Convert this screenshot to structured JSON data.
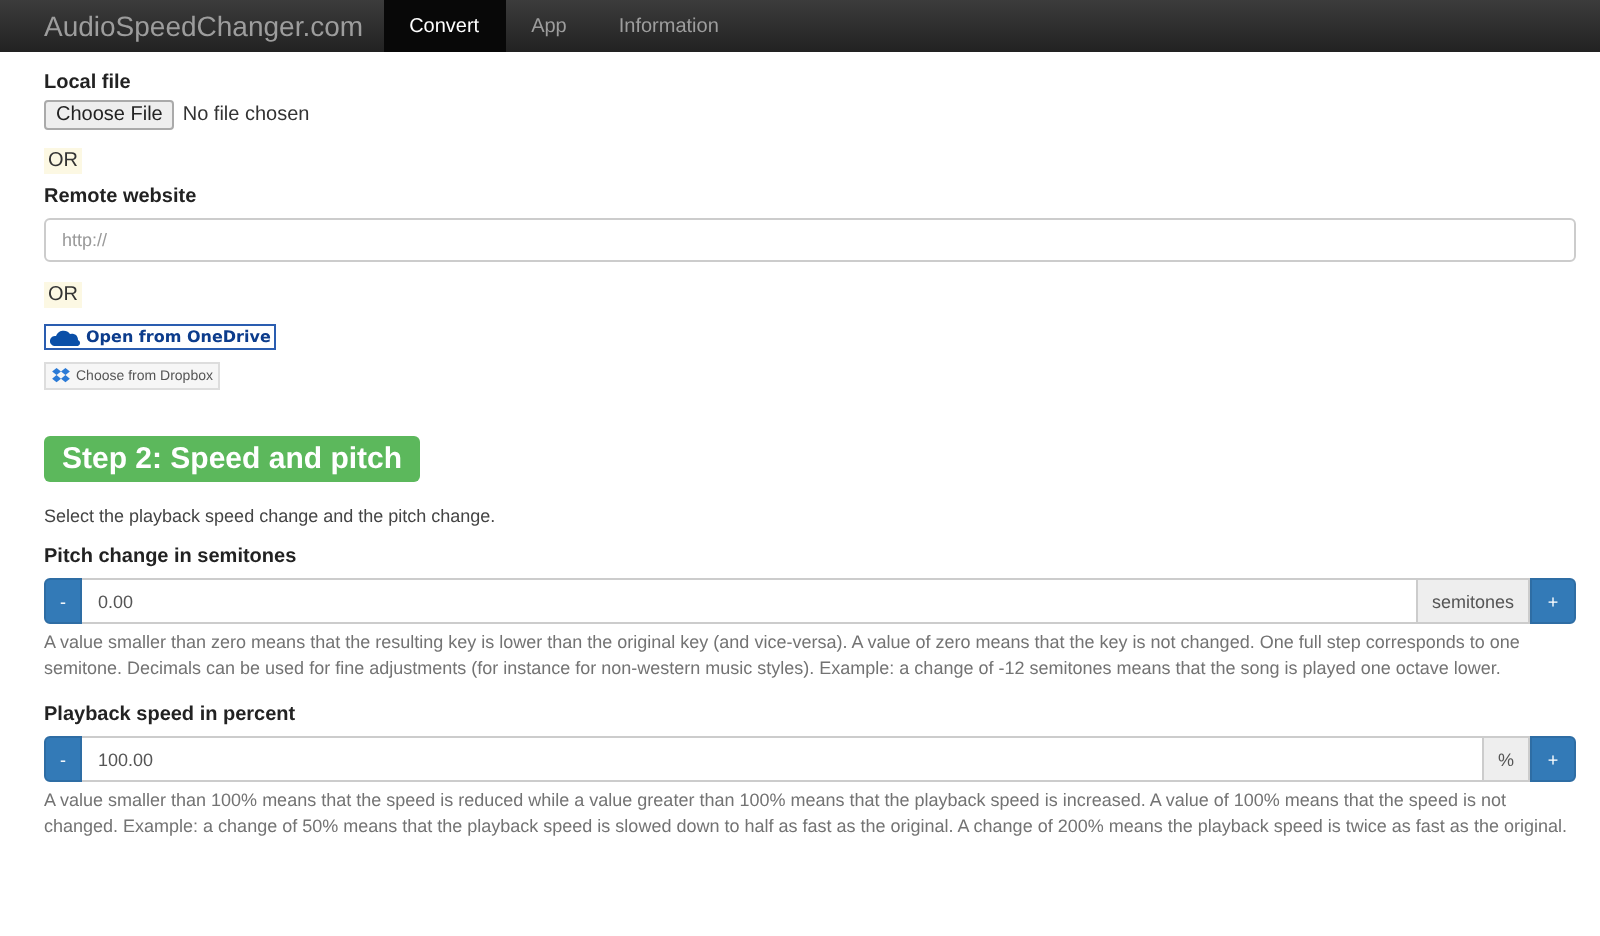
{
  "navbar": {
    "brand": "AudioSpeedChanger.com",
    "tabs": [
      {
        "label": "Convert",
        "selected": true
      },
      {
        "label": "App",
        "selected": false
      },
      {
        "label": "Information",
        "selected": false
      }
    ]
  },
  "local_file": {
    "label": "Local file",
    "button": "Choose File",
    "status": "No file chosen"
  },
  "or_1": "OR",
  "remote_website": {
    "label": "Remote website",
    "placeholder": "http://"
  },
  "or_2": "OR",
  "onedrive_button": "Open from OneDrive",
  "dropbox_button": "Choose from Dropbox",
  "step_2": {
    "title": "Step 2: Speed and pitch",
    "description": "Select the playback speed change and the pitch change."
  },
  "controls": [
    {
      "label": "Pitch change in semitones",
      "minus": "-",
      "value": "0.00",
      "unit": "semitones",
      "plus": "+",
      "help": "A value smaller than zero means that the resulting key is lower than the original key (and vice-versa). A value of zero means that the key is not changed. One full step corresponds to one semitone. Decimals can be used for fine adjustments (for instance for non-western music styles). Example: a change of -12 semitones means that the song is played one octave lower."
    },
    {
      "label": "Playback speed in percent",
      "minus": "-",
      "value": "100.00",
      "unit": "%",
      "plus": "+",
      "help": "A value smaller than 100% means that the speed is reduced while a value greater than 100% means that the playback speed is increased. A value of 100% means that the speed is not changed. Example: a change of 50% means that the playback speed is slowed down to half as fast as the original. A change of 200% means the playback speed is twice as fast as the original."
    }
  ]
}
